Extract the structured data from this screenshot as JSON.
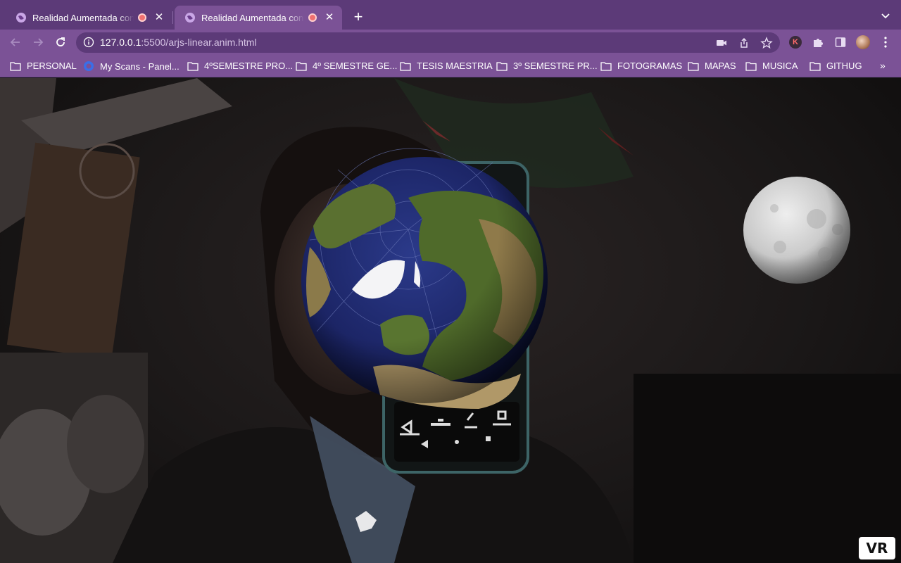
{
  "tabs": [
    {
      "title": "Realidad Aumentada con A-Frame",
      "active": false
    },
    {
      "title": "Realidad Aumentada con A-Frame",
      "active": true
    }
  ],
  "toolbar": {
    "url_host": "127.0.0.1",
    "url_rest": ":5500/arjs-linear.anim.html",
    "extension_k_label": "K"
  },
  "bookmarks": [
    {
      "label": "PERSONAL",
      "icon": "folder-icon"
    },
    {
      "label": "My Scans - Panel...",
      "icon": "scan-icon"
    },
    {
      "label": "4ºSEMESTRE PRO...",
      "icon": "folder-icon"
    },
    {
      "label": "4º SEMESTRE GE...",
      "icon": "folder-icon"
    },
    {
      "label": "TESIS MAESTRIA",
      "icon": "folder-icon"
    },
    {
      "label": "3º SEMESTRE PR...",
      "icon": "folder-icon"
    },
    {
      "label": "FOTOGRAMAS",
      "icon": "folder-icon"
    },
    {
      "label": "MAPAS",
      "icon": "folder-icon"
    },
    {
      "label": "MUSICA",
      "icon": "folder-icon"
    },
    {
      "label": "GITHUG",
      "icon": "folder-icon"
    }
  ],
  "bookmarks_more": "»",
  "scene": {
    "vr_label": "VR"
  },
  "colors": {
    "tabstrip": "#5c3a78",
    "toolbar": "#7b5296",
    "omnibox": "#5c3a78"
  }
}
